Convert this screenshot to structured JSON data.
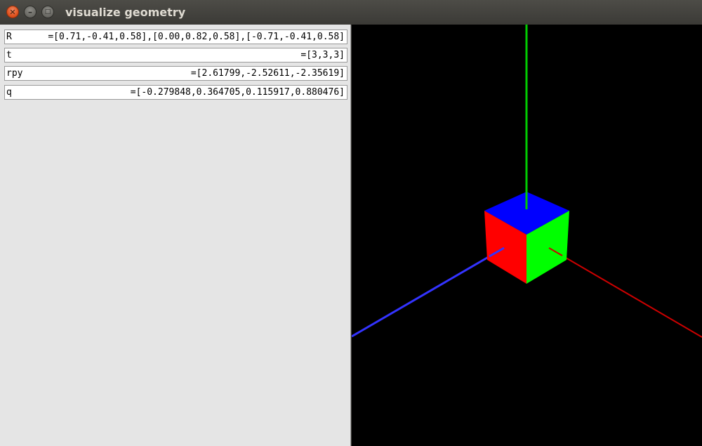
{
  "window": {
    "title": "visualize geometry",
    "close_glyph": "✕",
    "minimize_glyph": "–",
    "maximize_glyph": "□"
  },
  "fields": [
    {
      "label": "R",
      "value": "=[0.71,-0.41,0.58],[0.00,0.82,0.58],[-0.71,-0.41,0.58]"
    },
    {
      "label": "t",
      "value": "=[3,3,3]"
    },
    {
      "label": "rpy",
      "value": "=[2.61799,-2.52611,-2.35619]"
    },
    {
      "label": "q",
      "value": "=[-0.279848,0.364705,0.115917,0.880476]"
    }
  ],
  "viewport": {
    "background": "#000000",
    "cube_colors": {
      "top": "#0000ff",
      "left": "#ff0000",
      "right": "#00ff00"
    },
    "axis_colors": {
      "x": "#cc0000",
      "y": "#00cc00",
      "z": "#3333ff"
    }
  }
}
